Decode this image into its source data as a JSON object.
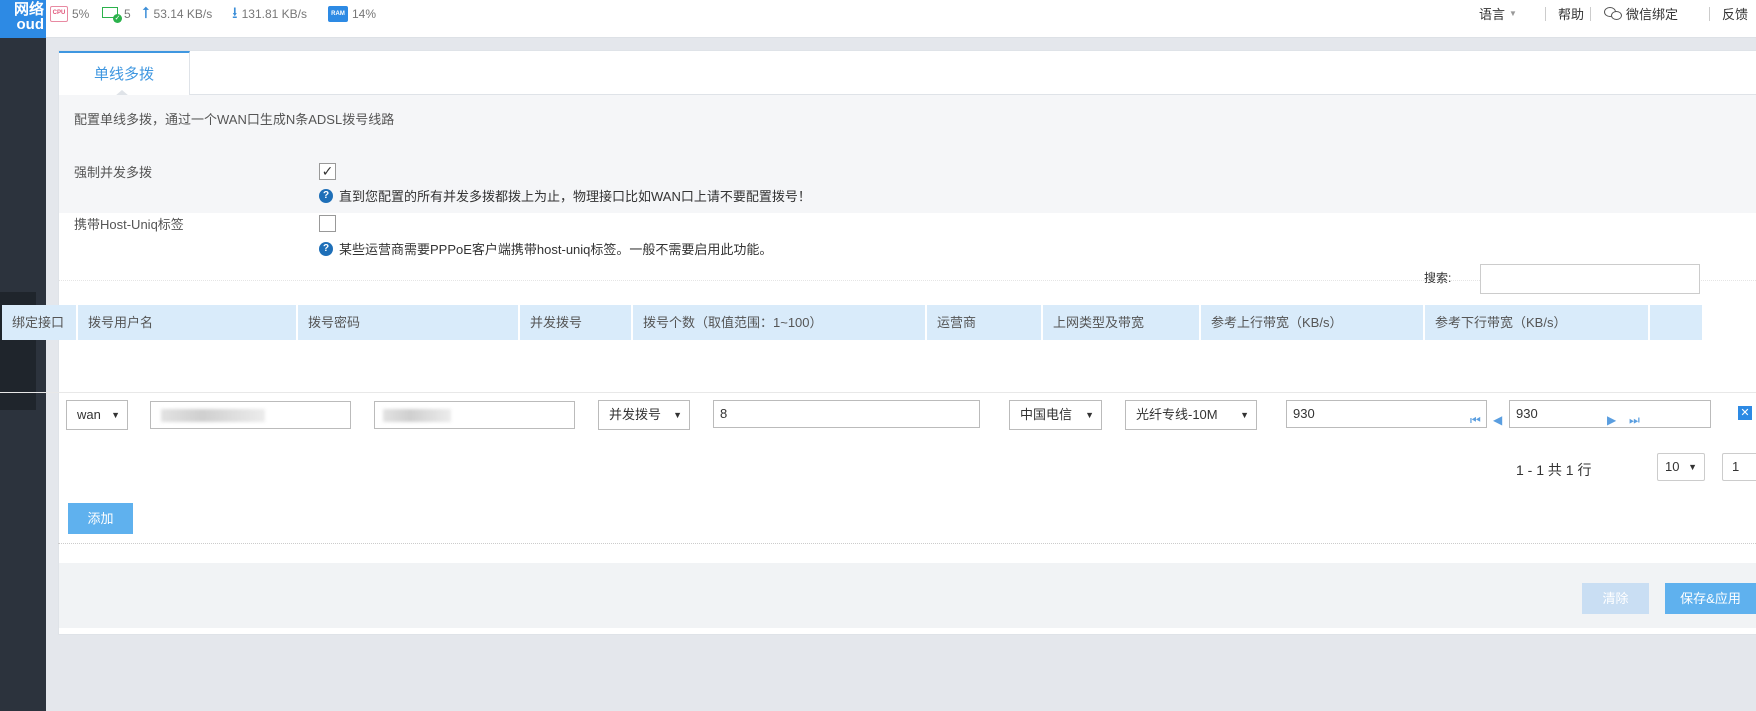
{
  "logo": {
    "line1": "网络",
    "line2": "oud"
  },
  "status": {
    "cpu_label": "CPU",
    "cpu": "5%",
    "devices": "5",
    "upload": "53.14 KB/s",
    "download": "131.81 KB/s",
    "ram_label": "RAM",
    "ram": "14%"
  },
  "top_menu": {
    "language": "语言",
    "help": "帮助",
    "wechat": "微信绑定",
    "feedback": "反馈"
  },
  "tab": {
    "label": "单线多拨"
  },
  "description": "配置单线多拨，通过一个WAN口生成N条ADSL拨号线路",
  "options": {
    "force_concurrent": {
      "label": "强制并发多拨",
      "checked": true,
      "hint": "直到您配置的所有并发多拨都拨上为止，物理接口比如WAN口上请不要配置拨号！"
    },
    "host_uniq": {
      "label": "携带Host-Uniq标签",
      "checked": false,
      "hint": "某些运营商需要PPPoE客户端携带host-uniq标签。一般不需要启用此功能。"
    }
  },
  "search": {
    "label": "搜索:",
    "value": ""
  },
  "table": {
    "headers": [
      "绑定接口",
      "拨号用户名",
      "拨号密码",
      "并发拨号",
      "拨号个数（取值范围：1~100）",
      "运营商",
      "上网类型及带宽",
      "参考上行带宽（KB/s）",
      "参考下行带宽（KB/s）"
    ],
    "row": {
      "interface": "wan",
      "mode": "并发拨号",
      "count": "8",
      "isp": "中国电信",
      "net_type": "光纤专线-10M",
      "up_bw": "930",
      "down_bw": "930"
    }
  },
  "pagination": {
    "info": "1 - 1 共 1 行",
    "page_size": "10",
    "page": "1"
  },
  "buttons": {
    "add": "添加",
    "clear": "清除",
    "save": "保存&应用"
  },
  "colors": {
    "accent": "#3f97e0",
    "header_bg": "#d9ebfa",
    "button": "#5fb1ee",
    "sidebar": "#2c333d"
  }
}
